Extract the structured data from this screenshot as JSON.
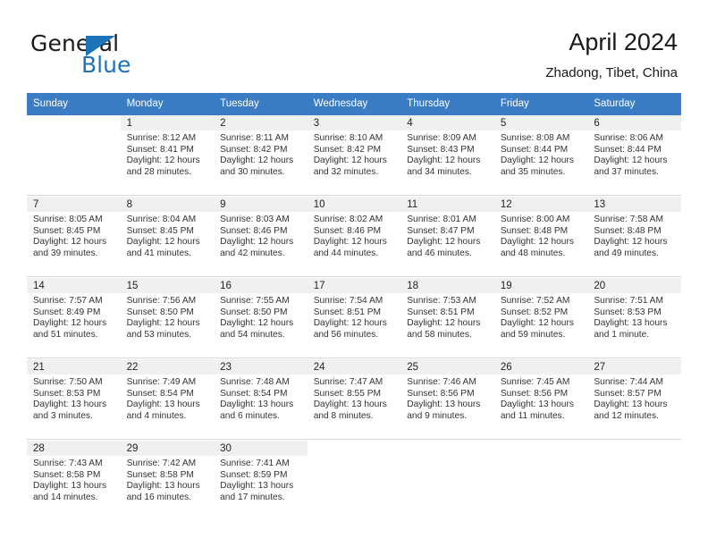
{
  "brand": {
    "name_top": "General",
    "name_bottom": "Blue",
    "triangle_color": "#1d72b8"
  },
  "header": {
    "title": "April 2024",
    "subtitle": "Zhadong, Tibet, China",
    "header_bg": "#3b7dc4"
  },
  "weekday_headers": [
    "Sunday",
    "Monday",
    "Tuesday",
    "Wednesday",
    "Thursday",
    "Friday",
    "Saturday"
  ],
  "labels": {
    "sunrise_prefix": "Sunrise:",
    "sunset_prefix": "Sunset:",
    "daylight_prefix": "Daylight:"
  },
  "weeks": [
    [
      {
        "day": "",
        "sunrise": "",
        "sunset": "",
        "daylight_line1": "",
        "daylight_line2": ""
      },
      {
        "day": "1",
        "sunrise": "Sunrise: 8:12 AM",
        "sunset": "Sunset: 8:41 PM",
        "daylight_line1": "Daylight: 12 hours",
        "daylight_line2": "and 28 minutes."
      },
      {
        "day": "2",
        "sunrise": "Sunrise: 8:11 AM",
        "sunset": "Sunset: 8:42 PM",
        "daylight_line1": "Daylight: 12 hours",
        "daylight_line2": "and 30 minutes."
      },
      {
        "day": "3",
        "sunrise": "Sunrise: 8:10 AM",
        "sunset": "Sunset: 8:42 PM",
        "daylight_line1": "Daylight: 12 hours",
        "daylight_line2": "and 32 minutes."
      },
      {
        "day": "4",
        "sunrise": "Sunrise: 8:09 AM",
        "sunset": "Sunset: 8:43 PM",
        "daylight_line1": "Daylight: 12 hours",
        "daylight_line2": "and 34 minutes."
      },
      {
        "day": "5",
        "sunrise": "Sunrise: 8:08 AM",
        "sunset": "Sunset: 8:44 PM",
        "daylight_line1": "Daylight: 12 hours",
        "daylight_line2": "and 35 minutes."
      },
      {
        "day": "6",
        "sunrise": "Sunrise: 8:06 AM",
        "sunset": "Sunset: 8:44 PM",
        "daylight_line1": "Daylight: 12 hours",
        "daylight_line2": "and 37 minutes."
      }
    ],
    [
      {
        "day": "7",
        "sunrise": "Sunrise: 8:05 AM",
        "sunset": "Sunset: 8:45 PM",
        "daylight_line1": "Daylight: 12 hours",
        "daylight_line2": "and 39 minutes."
      },
      {
        "day": "8",
        "sunrise": "Sunrise: 8:04 AM",
        "sunset": "Sunset: 8:45 PM",
        "daylight_line1": "Daylight: 12 hours",
        "daylight_line2": "and 41 minutes."
      },
      {
        "day": "9",
        "sunrise": "Sunrise: 8:03 AM",
        "sunset": "Sunset: 8:46 PM",
        "daylight_line1": "Daylight: 12 hours",
        "daylight_line2": "and 42 minutes."
      },
      {
        "day": "10",
        "sunrise": "Sunrise: 8:02 AM",
        "sunset": "Sunset: 8:46 PM",
        "daylight_line1": "Daylight: 12 hours",
        "daylight_line2": "and 44 minutes."
      },
      {
        "day": "11",
        "sunrise": "Sunrise: 8:01 AM",
        "sunset": "Sunset: 8:47 PM",
        "daylight_line1": "Daylight: 12 hours",
        "daylight_line2": "and 46 minutes."
      },
      {
        "day": "12",
        "sunrise": "Sunrise: 8:00 AM",
        "sunset": "Sunset: 8:48 PM",
        "daylight_line1": "Daylight: 12 hours",
        "daylight_line2": "and 48 minutes."
      },
      {
        "day": "13",
        "sunrise": "Sunrise: 7:58 AM",
        "sunset": "Sunset: 8:48 PM",
        "daylight_line1": "Daylight: 12 hours",
        "daylight_line2": "and 49 minutes."
      }
    ],
    [
      {
        "day": "14",
        "sunrise": "Sunrise: 7:57 AM",
        "sunset": "Sunset: 8:49 PM",
        "daylight_line1": "Daylight: 12 hours",
        "daylight_line2": "and 51 minutes."
      },
      {
        "day": "15",
        "sunrise": "Sunrise: 7:56 AM",
        "sunset": "Sunset: 8:50 PM",
        "daylight_line1": "Daylight: 12 hours",
        "daylight_line2": "and 53 minutes."
      },
      {
        "day": "16",
        "sunrise": "Sunrise: 7:55 AM",
        "sunset": "Sunset: 8:50 PM",
        "daylight_line1": "Daylight: 12 hours",
        "daylight_line2": "and 54 minutes."
      },
      {
        "day": "17",
        "sunrise": "Sunrise: 7:54 AM",
        "sunset": "Sunset: 8:51 PM",
        "daylight_line1": "Daylight: 12 hours",
        "daylight_line2": "and 56 minutes."
      },
      {
        "day": "18",
        "sunrise": "Sunrise: 7:53 AM",
        "sunset": "Sunset: 8:51 PM",
        "daylight_line1": "Daylight: 12 hours",
        "daylight_line2": "and 58 minutes."
      },
      {
        "day": "19",
        "sunrise": "Sunrise: 7:52 AM",
        "sunset": "Sunset: 8:52 PM",
        "daylight_line1": "Daylight: 12 hours",
        "daylight_line2": "and 59 minutes."
      },
      {
        "day": "20",
        "sunrise": "Sunrise: 7:51 AM",
        "sunset": "Sunset: 8:53 PM",
        "daylight_line1": "Daylight: 13 hours",
        "daylight_line2": "and 1 minute."
      }
    ],
    [
      {
        "day": "21",
        "sunrise": "Sunrise: 7:50 AM",
        "sunset": "Sunset: 8:53 PM",
        "daylight_line1": "Daylight: 13 hours",
        "daylight_line2": "and 3 minutes."
      },
      {
        "day": "22",
        "sunrise": "Sunrise: 7:49 AM",
        "sunset": "Sunset: 8:54 PM",
        "daylight_line1": "Daylight: 13 hours",
        "daylight_line2": "and 4 minutes."
      },
      {
        "day": "23",
        "sunrise": "Sunrise: 7:48 AM",
        "sunset": "Sunset: 8:54 PM",
        "daylight_line1": "Daylight: 13 hours",
        "daylight_line2": "and 6 minutes."
      },
      {
        "day": "24",
        "sunrise": "Sunrise: 7:47 AM",
        "sunset": "Sunset: 8:55 PM",
        "daylight_line1": "Daylight: 13 hours",
        "daylight_line2": "and 8 minutes."
      },
      {
        "day": "25",
        "sunrise": "Sunrise: 7:46 AM",
        "sunset": "Sunset: 8:56 PM",
        "daylight_line1": "Daylight: 13 hours",
        "daylight_line2": "and 9 minutes."
      },
      {
        "day": "26",
        "sunrise": "Sunrise: 7:45 AM",
        "sunset": "Sunset: 8:56 PM",
        "daylight_line1": "Daylight: 13 hours",
        "daylight_line2": "and 11 minutes."
      },
      {
        "day": "27",
        "sunrise": "Sunrise: 7:44 AM",
        "sunset": "Sunset: 8:57 PM",
        "daylight_line1": "Daylight: 13 hours",
        "daylight_line2": "and 12 minutes."
      }
    ],
    [
      {
        "day": "28",
        "sunrise": "Sunrise: 7:43 AM",
        "sunset": "Sunset: 8:58 PM",
        "daylight_line1": "Daylight: 13 hours",
        "daylight_line2": "and 14 minutes."
      },
      {
        "day": "29",
        "sunrise": "Sunrise: 7:42 AM",
        "sunset": "Sunset: 8:58 PM",
        "daylight_line1": "Daylight: 13 hours",
        "daylight_line2": "and 16 minutes."
      },
      {
        "day": "30",
        "sunrise": "Sunrise: 7:41 AM",
        "sunset": "Sunset: 8:59 PM",
        "daylight_line1": "Daylight: 13 hours",
        "daylight_line2": "and 17 minutes."
      },
      {
        "day": "",
        "sunrise": "",
        "sunset": "",
        "daylight_line1": "",
        "daylight_line2": ""
      },
      {
        "day": "",
        "sunrise": "",
        "sunset": "",
        "daylight_line1": "",
        "daylight_line2": ""
      },
      {
        "day": "",
        "sunrise": "",
        "sunset": "",
        "daylight_line1": "",
        "daylight_line2": ""
      },
      {
        "day": "",
        "sunrise": "",
        "sunset": "",
        "daylight_line1": "",
        "daylight_line2": ""
      }
    ]
  ]
}
